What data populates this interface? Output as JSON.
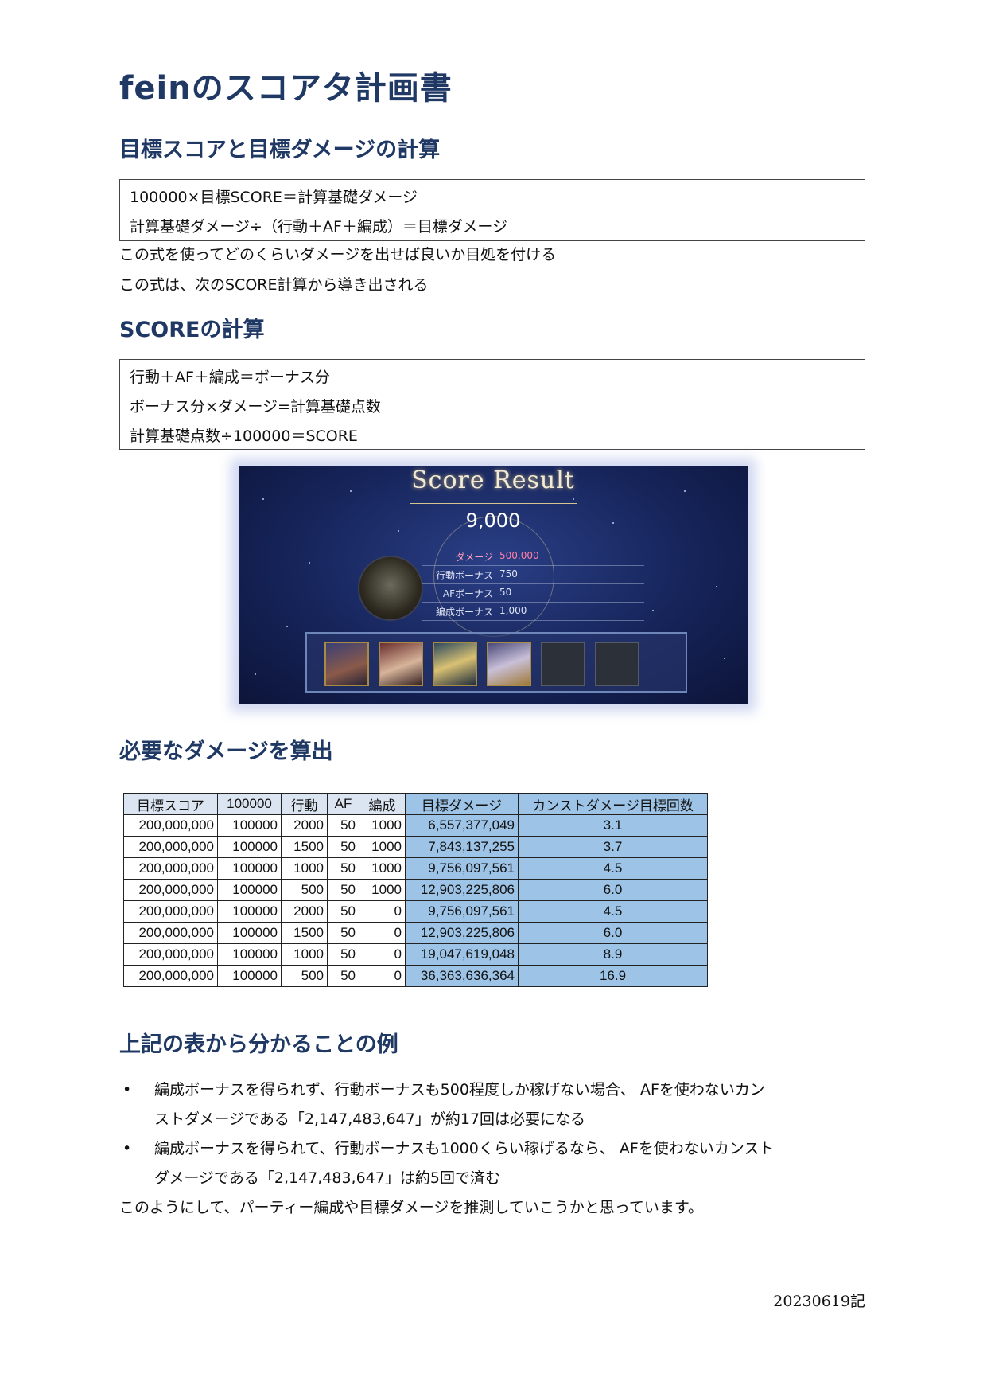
{
  "doc": {
    "title": "feinのスコアタ計画書",
    "section1": {
      "heading": "目標スコアと目標ダメージの計算",
      "box_lines": [
        "100000×目標SCORE＝計算基礎ダメージ",
        "計算基礎ダメージ÷（行動＋AF＋編成）＝目標ダメージ"
      ],
      "para_lines": [
        "この式を使ってどのくらいダメージを出せば良いか目処を付ける",
        "この式は、次のSCORE計算から導き出される"
      ]
    },
    "section2": {
      "heading": "SCOREの計算",
      "box_lines": [
        "行動＋AF＋編成＝ボーナス分",
        "ボーナス分×ダメージ=計算基礎点数",
        "計算基礎点数÷100000＝SCORE"
      ]
    },
    "score_result": {
      "title": "Score Result",
      "score": "9,000",
      "rows": [
        {
          "label": "ダメージ",
          "value": "500,000"
        },
        {
          "label": "行動ボーナス",
          "value": "750"
        },
        {
          "label": "AFボーナス",
          "value": "50"
        },
        {
          "label": "編成ボーナス",
          "value": "1,000"
        }
      ],
      "party_slots": 6,
      "filled_slots": 4
    },
    "section3": {
      "heading": "必要なダメージを算出",
      "table": {
        "headers": [
          "目標スコア",
          "100000",
          "行動",
          "AF",
          "編成",
          "目標ダメージ",
          "カンストダメージ目標回数"
        ],
        "rows": [
          [
            "200,000,000",
            "100000",
            "2000",
            "50",
            "1000",
            "6,557,377,049",
            "3.1"
          ],
          [
            "200,000,000",
            "100000",
            "1500",
            "50",
            "1000",
            "7,843,137,255",
            "3.7"
          ],
          [
            "200,000,000",
            "100000",
            "1000",
            "50",
            "1000",
            "9,756,097,561",
            "4.5"
          ],
          [
            "200,000,000",
            "100000",
            "500",
            "50",
            "1000",
            "12,903,225,806",
            "6.0"
          ],
          [
            "200,000,000",
            "100000",
            "2000",
            "50",
            "0",
            "9,756,097,561",
            "4.5"
          ],
          [
            "200,000,000",
            "100000",
            "1500",
            "50",
            "0",
            "12,903,225,806",
            "6.0"
          ],
          [
            "200,000,000",
            "100000",
            "1000",
            "50",
            "0",
            "19,047,619,048",
            "8.9"
          ],
          [
            "200,000,000",
            "100000",
            "500",
            "50",
            "0",
            "36,363,636,364",
            "16.9"
          ]
        ]
      }
    },
    "section4": {
      "heading": "上記の表から分かることの例",
      "bullets": [
        {
          "line1": "編成ボーナスを得られず、行動ボーナスも500程度しか稼げない場合、 AFを使わないカン",
          "line2": "ストダメージである「2,147,483,647」が約17回は必要になる"
        },
        {
          "line1": "編成ボーナスを得られて、行動ボーナスも1000くらい稼げるなら、 AFを使わないカンスト",
          "line2": "ダメージである「2,147,483,647」は約5回で済む"
        }
      ],
      "conclusion": "このようにして、パーティー編成や目標ダメージを推測していこうかと思っています。"
    },
    "footer_date": "20230619記"
  },
  "colors": {
    "heading": "#1f3864",
    "table_header": "#dbe5f1",
    "table_highlight": "#9dc3e6",
    "damage_value": "#ff7fa8"
  }
}
